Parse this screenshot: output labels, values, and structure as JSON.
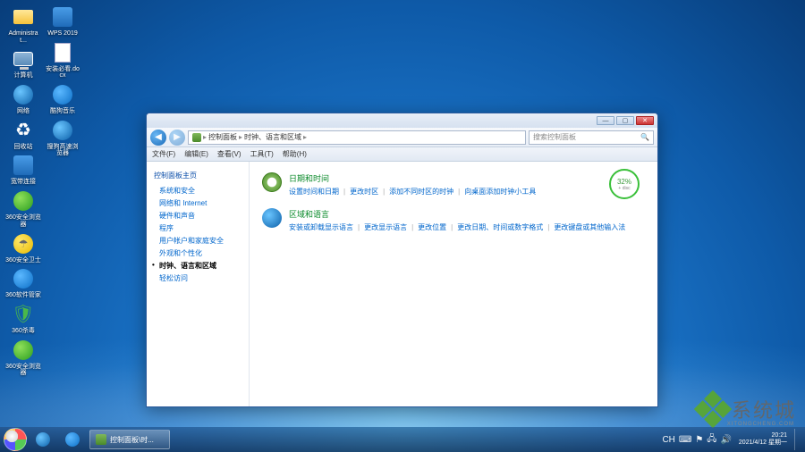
{
  "desktop_icons_col1": [
    {
      "label": "Administrat...",
      "icon": "folder"
    },
    {
      "label": "计算机",
      "icon": "computer"
    },
    {
      "label": "网络",
      "icon": "globe"
    },
    {
      "label": "回收站",
      "icon": "recycle"
    },
    {
      "label": "宽带连接",
      "icon": "app"
    },
    {
      "label": "360安全浏览器",
      "icon": "green"
    },
    {
      "label": "360安全卫士",
      "icon": "yellow"
    },
    {
      "label": "360软件管家",
      "icon": "blue"
    },
    {
      "label": "360杀毒",
      "icon": "shield"
    },
    {
      "label": "360安全浏览器",
      "icon": "green"
    }
  ],
  "desktop_icons_col2": [
    {
      "label": "WPS 2019",
      "icon": "app"
    },
    {
      "label": "安装必看.docx",
      "icon": "doc"
    },
    {
      "label": "酷狗音乐",
      "icon": "blue"
    },
    {
      "label": "搜狗高速浏览器",
      "icon": "globe"
    }
  ],
  "window": {
    "breadcrumb": {
      "root": "控制面板",
      "current": "时钟、语言和区域"
    },
    "search_placeholder": "搜索控制面板",
    "menus": [
      "文件(F)",
      "编辑(E)",
      "查看(V)",
      "工具(T)",
      "帮助(H)"
    ],
    "sidebar": {
      "heading": "控制面板主页",
      "items": [
        {
          "label": "系统和安全",
          "active": false
        },
        {
          "label": "网络和 Internet",
          "active": false
        },
        {
          "label": "硬件和声音",
          "active": false
        },
        {
          "label": "程序",
          "active": false
        },
        {
          "label": "用户帐户和家庭安全",
          "active": false
        },
        {
          "label": "外观和个性化",
          "active": false
        },
        {
          "label": "时钟、语言和区域",
          "active": true
        },
        {
          "label": "轻松访问",
          "active": false
        }
      ]
    },
    "categories": [
      {
        "title": "日期和时间",
        "links": [
          "设置时间和日期",
          "更改时区",
          "添加不同时区的时钟",
          "向桌面添加时钟小工具"
        ]
      },
      {
        "title": "区域和语言",
        "links": [
          "安装或卸载显示语言",
          "更改显示语言",
          "更改位置",
          "更改日期、时间或数字格式",
          "更改键盘或其他输入法"
        ]
      }
    ],
    "badge": {
      "value": "32%",
      "sub": "+ disc"
    }
  },
  "taskbar": {
    "task_label": "控制面板\\时...",
    "tray_text": "CH",
    "time": "20:21",
    "date": "2021/4/12 星期一"
  },
  "watermark": {
    "text": "系统城",
    "sub": "XITONGCHENG.COM"
  }
}
